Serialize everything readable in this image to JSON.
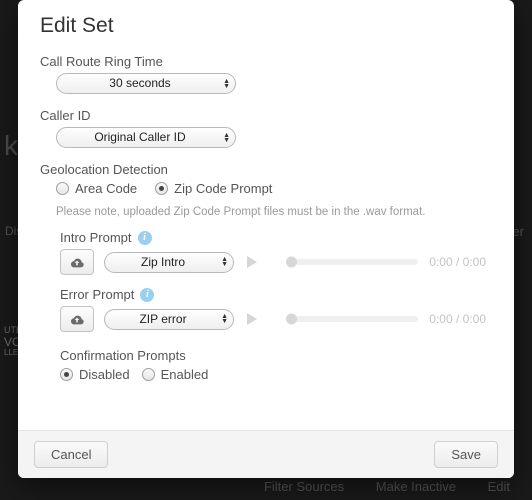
{
  "background": {
    "left_partial": "ka",
    "dist": "Dis",
    "ute": "UTE",
    "vc": "VC",
    "lle": "LLE",
    "filter": "ilter",
    "bottom": {
      "filter_sources": "Filter Sources",
      "make_inactive": "Make Inactive",
      "edit": "Edit"
    }
  },
  "modal": {
    "title": "Edit Set",
    "ring_time": {
      "label": "Call Route Ring Time",
      "value": "30 seconds"
    },
    "caller_id": {
      "label": "Caller ID",
      "value": "Original Caller ID"
    },
    "geolocation": {
      "label": "Geolocation Detection",
      "options": {
        "area_code": "Area Code",
        "zip_code_prompt": "Zip Code Prompt"
      },
      "selected": "zip_code_prompt",
      "hint": "Please note, uploaded Zip Code Prompt files must be in the .wav format."
    },
    "intro_prompt": {
      "label": "Intro Prompt",
      "select_value": "Zip Intro",
      "time": "0:00 / 0:00"
    },
    "error_prompt": {
      "label": "Error Prompt",
      "select_value": "ZIP error",
      "time": "0:00 / 0:00"
    },
    "confirmation": {
      "label": "Confirmation Prompts",
      "options": {
        "disabled": "Disabled",
        "enabled": "Enabled"
      },
      "selected": "disabled"
    },
    "buttons": {
      "cancel": "Cancel",
      "save": "Save"
    }
  }
}
